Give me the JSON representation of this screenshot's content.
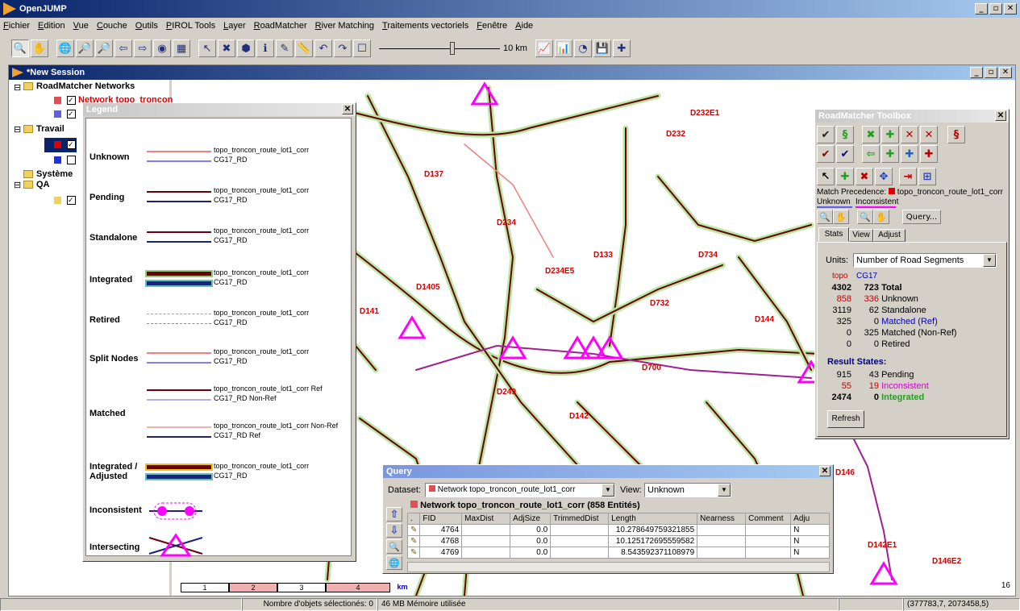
{
  "app": {
    "title": "OpenJUMP"
  },
  "menu": [
    "Fichier",
    "Edition",
    "Vue",
    "Couche",
    "Outils",
    "PIROL Tools",
    "Layer",
    "RoadMatcher",
    "River Matching",
    "Traitements vectoriels",
    "Fenêtre",
    "Aide"
  ],
  "toolbar": {
    "scale_label": "10 km"
  },
  "session": {
    "title": "*New Session"
  },
  "layers": {
    "rm_networks": "RoadMatcher Networks",
    "network_topo": "Network topo_troncon_route",
    "travail": "Travail",
    "systeme": "Système",
    "qa": "QA"
  },
  "legend": {
    "title": "Legend",
    "rows": [
      {
        "name": "Unknown",
        "ref": "topo_troncon_route_lot1_corr",
        "sub": "CG17_RD"
      },
      {
        "name": "Pending",
        "ref": "topo_troncon_route_lot1_corr",
        "sub": "CG17_RD"
      },
      {
        "name": "Standalone",
        "ref": "topo_troncon_route_lot1_corr",
        "sub": "CG17_RD"
      },
      {
        "name": "Integrated",
        "ref": "topo_troncon_route_lot1_corr",
        "sub": "CG17_RD"
      },
      {
        "name": "Retired",
        "ref": "topo_troncon_route_lot1_corr",
        "sub": "CG17_RD"
      },
      {
        "name": "Split Nodes",
        "ref": "topo_troncon_route_lot1_corr",
        "sub": "CG17_RD"
      },
      {
        "name": "Matched",
        "ref": "topo_troncon_route_lot1_corr Ref",
        "sub": "CG17_RD Non-Ref",
        "ref2": "topo_troncon_route_lot1_corr Non-Ref",
        "sub2": "CG17_RD Ref"
      },
      {
        "name": "Integrated / Adjusted",
        "ref": "topo_troncon_route_lot1_corr",
        "sub": "CG17_RD"
      },
      {
        "name": "Inconsistent"
      },
      {
        "name": "Intersecting"
      }
    ]
  },
  "toolbox": {
    "title": "RoadMatcher Toolbox",
    "match_precedence_label": "Match Precedence:",
    "match_precedence_value": "topo_troncon_route_lot1_corr",
    "filter_unknown": "Unknown",
    "filter_inconsistent": "Inconsistent",
    "query_button": "Query...",
    "tabs": [
      "Stats",
      "View",
      "Adjust"
    ],
    "units_label": "Units:",
    "units_value": "Number of Road Segments",
    "col_topo": "topo",
    "col_cg17": "CG17",
    "stats": [
      {
        "a": "4302",
        "b": "723",
        "label": "Total",
        "bold": true
      },
      {
        "a": "858",
        "b": "336",
        "label": "Unknown",
        "color": "#c00000"
      },
      {
        "a": "3119",
        "b": "62",
        "label": "Standalone"
      },
      {
        "a": "325",
        "b": "0",
        "label": "Matched (Ref)",
        "lcolor": "#0000c0"
      },
      {
        "a": "0",
        "b": "325",
        "label": "Matched (Non-Ref)"
      },
      {
        "a": "0",
        "b": "0",
        "label": "Retired"
      }
    ],
    "result_states_label": "Result States:",
    "result_states": [
      {
        "a": "915",
        "b": "43",
        "label": "Pending"
      },
      {
        "a": "55",
        "b": "19",
        "label": "Inconsistent",
        "color": "#c00000",
        "lcolor": "#d000d0"
      },
      {
        "a": "2474",
        "b": "0",
        "label": "Integrated",
        "bold": true,
        "lcolor": "#20a020"
      }
    ],
    "refresh_button": "Refresh"
  },
  "query": {
    "title": "Query",
    "dataset_label": "Dataset:",
    "dataset_value": "Network topo_troncon_route_lot1_corr",
    "view_label": "View:",
    "view_value": "Unknown",
    "table_title": "Network topo_troncon_route_lot1_corr (858 Entités)",
    "columns": [
      "FID",
      "MaxDist",
      "AdjSize",
      "TrimmedDist",
      "Length",
      "Nearness",
      "Comment",
      "Adju"
    ],
    "rows": [
      [
        "4764",
        "",
        "0.0",
        "",
        "10.278649759321855",
        "",
        "",
        "N"
      ],
      [
        "4768",
        "",
        "0.0",
        "",
        "10.125172695559582",
        "",
        "",
        "N"
      ],
      [
        "4769",
        "",
        "0.0",
        "",
        "8.543592371108979",
        "",
        "",
        "N"
      ]
    ]
  },
  "map": {
    "scale_bar": [
      "1",
      "2",
      "3",
      "4",
      "km"
    ],
    "corner_number": "16",
    "road_labels": [
      "D232E1",
      "D137",
      "D232",
      "D234",
      "D234E5",
      "D734",
      "D133",
      "D732",
      "D700",
      "D142",
      "D144",
      "D146",
      "D146E2",
      "D142E1",
      "D249",
      "D141",
      "D1405"
    ]
  },
  "status": {
    "selected": "Nombre d'objets sélectionés: 0",
    "memory": "46 MB Mémoire utilisée",
    "coords": "(377783,7, 2073458,5)"
  }
}
